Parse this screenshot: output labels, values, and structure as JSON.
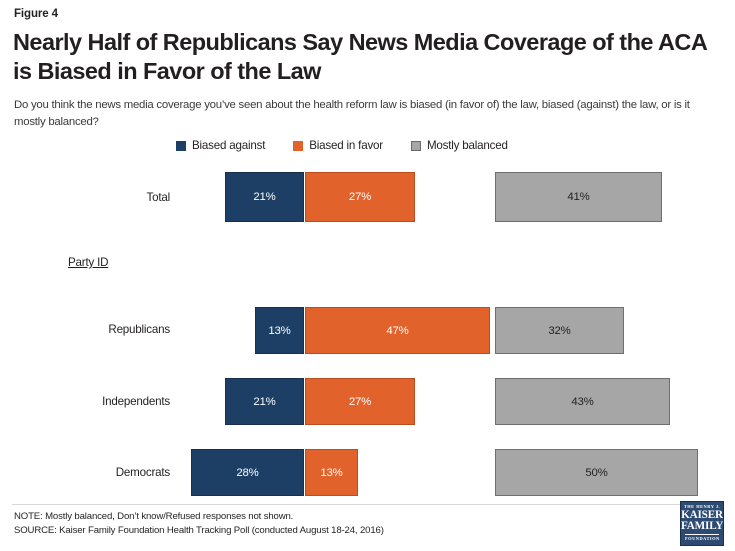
{
  "figure_label": "Figure 4",
  "title": "Nearly Half of Republicans Say News Media Coverage of the ACA is Biased in Favor of the Law",
  "subtitle": "Do you think the news media coverage you’ve seen about the health reform law is biased (in favor of) the law, biased (against) the law, or is it mostly balanced?",
  "legend": [
    {
      "label": "Biased against",
      "color": "#1d3f66"
    },
    {
      "label": "Biased in favor",
      "color": "#e2622b"
    },
    {
      "label": "Mostly balanced",
      "color": "#a6a6a6"
    }
  ],
  "group_label": "Party ID",
  "rows": [
    {
      "label": "Total",
      "against": "21%",
      "favor": "27%",
      "balanced": "41%"
    },
    {
      "label": "Republicans",
      "against": "13%",
      "favor": "47%",
      "balanced": "32%"
    },
    {
      "label": "Independents",
      "against": "21%",
      "favor": "27%",
      "balanced": "43%"
    },
    {
      "label": "Democrats",
      "against": "28%",
      "favor": "13%",
      "balanced": "50%"
    }
  ],
  "note": "NOTE: Mostly balanced, Don’t know/Refused responses not shown.",
  "source": "SOURCE: Kaiser Family Foundation Health Tracking Poll (conducted August 18-24, 2016)",
  "logo": {
    "line1": "THE HENRY J.",
    "line2": "KAISER",
    "line3": "FAMILY",
    "line4": "FOUNDATION"
  },
  "chart_data": {
    "type": "bar",
    "title": "Nearly Half of Republicans Say News Media Coverage of the ACA is Biased in Favor of the Law",
    "subtitle": "Do you think the news media coverage you’ve seen about the health reform law is biased (in favor of) the law, biased (against) the law, or is it mostly balanced?",
    "orientation": "horizontal",
    "categories": [
      "Total",
      "Republicans",
      "Independents",
      "Democrats"
    ],
    "series": [
      {
        "name": "Biased against",
        "color": "#1d3f66",
        "values": [
          21,
          13,
          21,
          28
        ],
        "unit": "%"
      },
      {
        "name": "Biased in favor",
        "color": "#e2622b",
        "values": [
          27,
          47,
          27,
          13
        ],
        "unit": "%"
      },
      {
        "name": "Mostly balanced",
        "color": "#a6a6a6",
        "values": [
          41,
          32,
          43,
          50
        ],
        "unit": "%"
      }
    ],
    "data_labels": [
      "21%",
      "27%",
      "41%",
      "13%",
      "47%",
      "32%",
      "21%",
      "27%",
      "43%",
      "28%",
      "13%",
      "50%"
    ],
    "xlabel": "",
    "ylabel": "",
    "grid": false,
    "legend_position": "top",
    "annotations": [
      "Party ID"
    ],
    "note": "NOTE: Mostly balanced, Don’t know/Refused responses not shown.",
    "source": "SOURCE: Kaiser Family Foundation Health Tracking Poll (conducted August 18-24, 2016)"
  }
}
